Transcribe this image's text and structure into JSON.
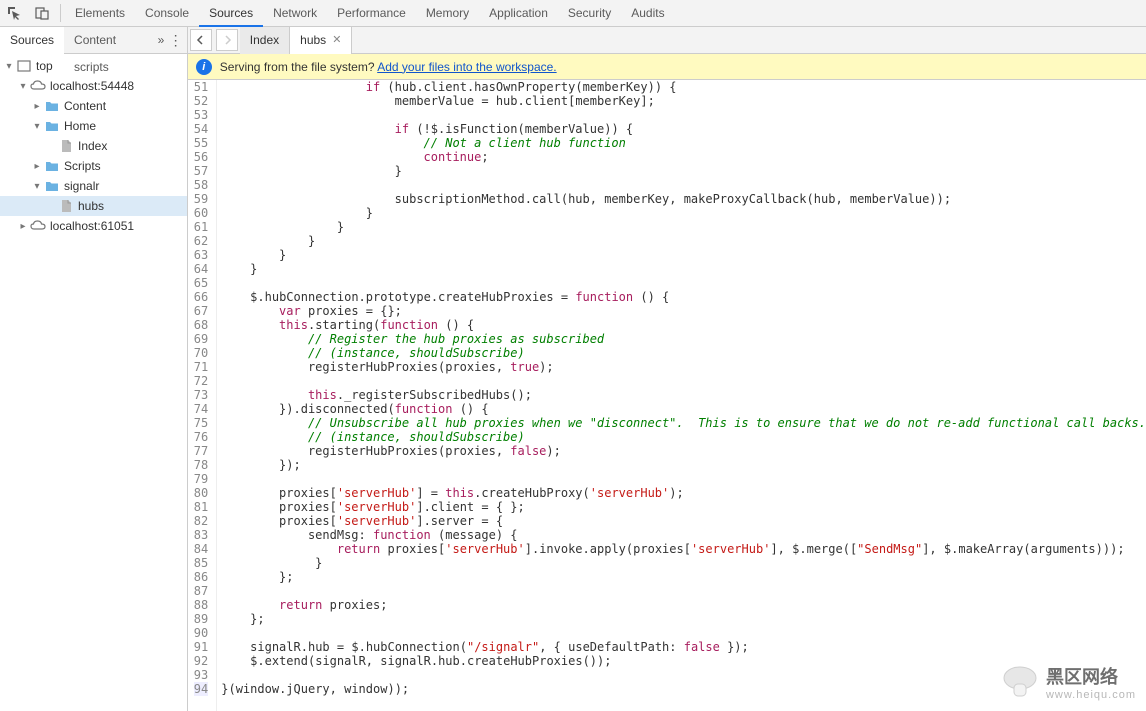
{
  "toolbar": {
    "tabs": [
      "Elements",
      "Console",
      "Sources",
      "Network",
      "Performance",
      "Memory",
      "Application",
      "Security",
      "Audits"
    ],
    "active": "Sources"
  },
  "subtabs": {
    "tabs": [
      "Sources",
      "Content scripts"
    ],
    "active": "Sources",
    "more": "»"
  },
  "tree": {
    "items": [
      {
        "indent": 0,
        "arrow": "▾",
        "icon": "frame",
        "label": "top"
      },
      {
        "indent": 1,
        "arrow": "▾",
        "icon": "cloud",
        "label": "localhost:54448"
      },
      {
        "indent": 2,
        "arrow": "▸",
        "icon": "folder",
        "label": "Content"
      },
      {
        "indent": 2,
        "arrow": "▾",
        "icon": "folder",
        "label": "Home"
      },
      {
        "indent": 3,
        "arrow": "",
        "icon": "file",
        "label": "Index"
      },
      {
        "indent": 2,
        "arrow": "▸",
        "icon": "folder",
        "label": "Scripts"
      },
      {
        "indent": 2,
        "arrow": "▾",
        "icon": "folder",
        "label": "signalr"
      },
      {
        "indent": 3,
        "arrow": "",
        "icon": "file",
        "label": "hubs",
        "selected": true
      },
      {
        "indent": 1,
        "arrow": "▸",
        "icon": "cloud",
        "label": "localhost:61051"
      }
    ]
  },
  "editorTabs": {
    "tabs": [
      {
        "label": "Index",
        "close": false
      },
      {
        "label": "hubs",
        "close": true,
        "active": true
      }
    ]
  },
  "infobar": {
    "text": "Serving from the file system?",
    "link": "Add your files into the workspace."
  },
  "code": {
    "start": 51,
    "lines": [
      {
        "n": 51,
        "t": "                    if (hub.client.hasOwnProperty(memberKey)) {"
      },
      {
        "n": 52,
        "t": "                        memberValue = hub.client[memberKey];"
      },
      {
        "n": 53,
        "t": ""
      },
      {
        "n": 54,
        "t": "                        if (!$.isFunction(memberValue)) {"
      },
      {
        "n": 55,
        "t": "                            // Not a client hub function"
      },
      {
        "n": 56,
        "t": "                            continue;"
      },
      {
        "n": 57,
        "t": "                        }"
      },
      {
        "n": 58,
        "t": ""
      },
      {
        "n": 59,
        "t": "                        subscriptionMethod.call(hub, memberKey, makeProxyCallback(hub, memberValue));"
      },
      {
        "n": 60,
        "t": "                    }"
      },
      {
        "n": 61,
        "t": "                }"
      },
      {
        "n": 62,
        "t": "            }"
      },
      {
        "n": 63,
        "t": "        }"
      },
      {
        "n": 64,
        "t": "    }"
      },
      {
        "n": 65,
        "t": ""
      },
      {
        "n": 66,
        "t": "    $.hubConnection.prototype.createHubProxies = function () {"
      },
      {
        "n": 67,
        "t": "        var proxies = {};"
      },
      {
        "n": 68,
        "t": "        this.starting(function () {"
      },
      {
        "n": 69,
        "t": "            // Register the hub proxies as subscribed"
      },
      {
        "n": 70,
        "t": "            // (instance, shouldSubscribe)"
      },
      {
        "n": 71,
        "t": "            registerHubProxies(proxies, true);"
      },
      {
        "n": 72,
        "t": ""
      },
      {
        "n": 73,
        "t": "            this._registerSubscribedHubs();"
      },
      {
        "n": 74,
        "t": "        }).disconnected(function () {"
      },
      {
        "n": 75,
        "t": "            // Unsubscribe all hub proxies when we \"disconnect\".  This is to ensure that we do not re-add functional call backs."
      },
      {
        "n": 76,
        "t": "            // (instance, shouldSubscribe)"
      },
      {
        "n": 77,
        "t": "            registerHubProxies(proxies, false);"
      },
      {
        "n": 78,
        "t": "        });"
      },
      {
        "n": 79,
        "t": ""
      },
      {
        "n": 80,
        "t": "        proxies['serverHub'] = this.createHubProxy('serverHub');"
      },
      {
        "n": 81,
        "t": "        proxies['serverHub'].client = { };"
      },
      {
        "n": 82,
        "t": "        proxies['serverHub'].server = {"
      },
      {
        "n": 83,
        "t": "            sendMsg: function (message) {"
      },
      {
        "n": 84,
        "t": "                return proxies['serverHub'].invoke.apply(proxies['serverHub'], $.merge([\"SendMsg\"], $.makeArray(arguments)));"
      },
      {
        "n": 85,
        "t": "             }"
      },
      {
        "n": 86,
        "t": "        };"
      },
      {
        "n": 87,
        "t": ""
      },
      {
        "n": 88,
        "t": "        return proxies;"
      },
      {
        "n": 89,
        "t": "    };"
      },
      {
        "n": 90,
        "t": ""
      },
      {
        "n": 91,
        "t": "    signalR.hub = $.hubConnection(\"/signalr\", { useDefaultPath: false });"
      },
      {
        "n": 92,
        "t": "    $.extend(signalR, signalR.hub.createHubProxies());"
      },
      {
        "n": 93,
        "t": ""
      },
      {
        "n": 94,
        "t": "}(window.jQuery, window));"
      }
    ]
  },
  "watermark": {
    "text1": "黑区网络",
    "text2": "www.heiqu.com"
  }
}
